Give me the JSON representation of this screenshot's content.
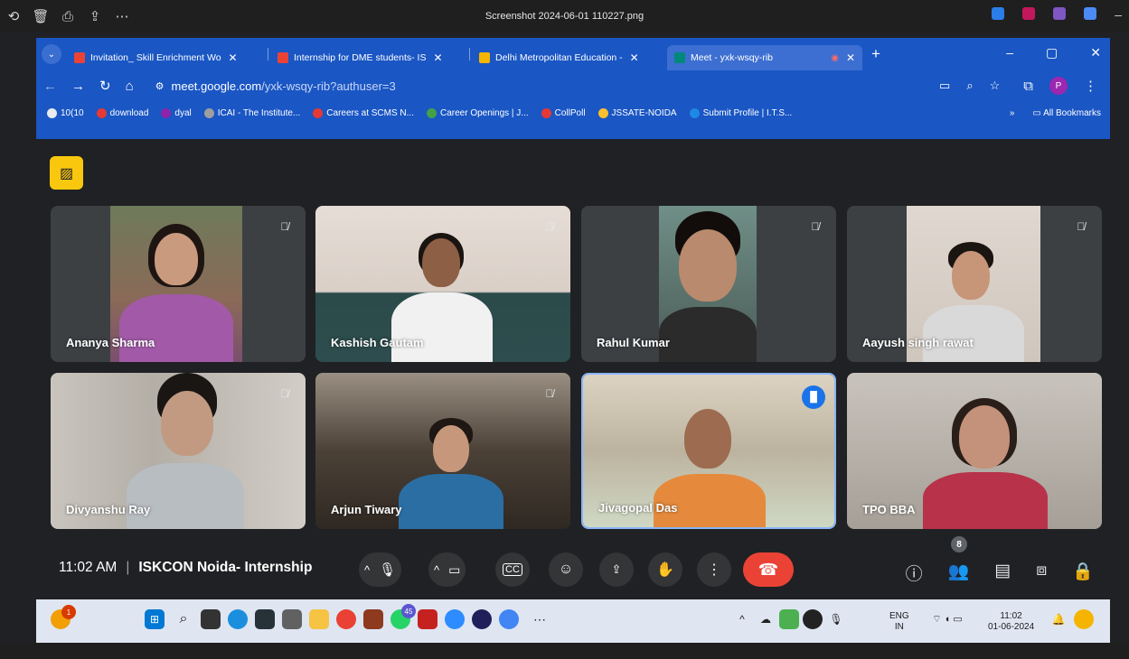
{
  "viewer": {
    "title": "Screenshot 2024-06-01 110227.png",
    "icons": [
      "rotate-icon",
      "delete-icon",
      "print-icon",
      "share-icon",
      "more-icon"
    ]
  },
  "browser": {
    "tabs": [
      {
        "label": "Invitation_ Skill Enrichment Wo",
        "icon": "gmail-icon",
        "color": "#ea4335"
      },
      {
        "label": "Internship for DME students- IS",
        "icon": "gmail-icon",
        "color": "#ea4335"
      },
      {
        "label": "Delhi Metropolitan Education -",
        "icon": "dme-icon",
        "color": "#f4b400"
      },
      {
        "label": "Meet - yxk-wsqy-rib",
        "icon": "meet-icon",
        "color": "#00897b"
      }
    ],
    "url_host": "meet.google.com",
    "url_path": "/yxk-wsqy-rib?authuser=3",
    "profile_initial": "P",
    "bookmarks": [
      {
        "label": "10(10",
        "color": "#e8eaed"
      },
      {
        "label": "download",
        "color": "#e53935"
      },
      {
        "label": "dyal",
        "color": "#8e24aa"
      },
      {
        "label": "ICAI - The Institute...",
        "color": "#9e9e9e"
      },
      {
        "label": "Careers at SCMS N...",
        "color": "#e53935"
      },
      {
        "label": "Career Openings | J...",
        "color": "#43a047"
      },
      {
        "label": "CollPoll",
        "color": "#e53935"
      },
      {
        "label": "JSSATE-NOIDA",
        "color": "#fbc02d"
      },
      {
        "label": "Submit Profile | I.T.S...",
        "color": "#1e88e5"
      }
    ],
    "all_bookmarks": "All Bookmarks"
  },
  "participants": [
    {
      "name": "Ananya Sharma",
      "muted": true
    },
    {
      "name": "Kashish Gautam",
      "muted": true
    },
    {
      "name": "Rahul Kumar",
      "muted": true
    },
    {
      "name": "Aayush singh rawat",
      "muted": true
    },
    {
      "name": "Divyanshu Ray",
      "muted": true
    },
    {
      "name": "Arjun Tiwary",
      "muted": true
    },
    {
      "name": "Jivagopal Das",
      "muted": false,
      "speaking": true
    },
    {
      "name": "TPO BBA",
      "muted": false
    }
  ],
  "meeting": {
    "time": "11:02 AM",
    "separator": "|",
    "title": "ISKCON Noida- Internship",
    "people_count": "8"
  },
  "taskbar": {
    "language": "ENG",
    "region": "IN",
    "clock_time": "11:02",
    "clock_date": "01-06-2024",
    "notification_badge": "1",
    "whatsapp_badge": "45"
  }
}
